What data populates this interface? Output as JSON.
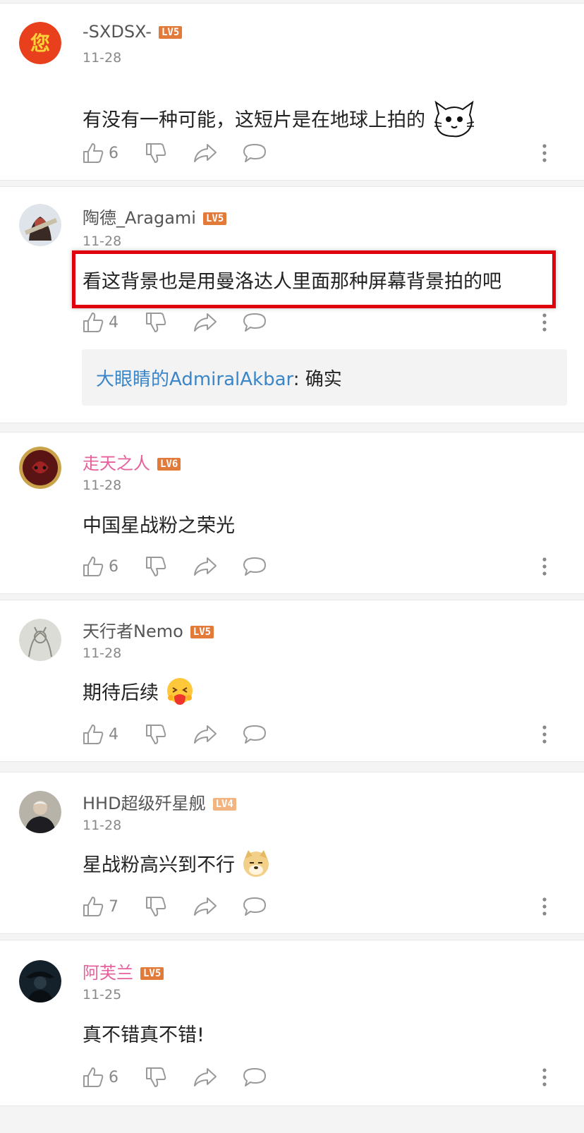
{
  "comments": [
    {
      "username": "-SXDSX-",
      "level": "LV5",
      "date": "11-28",
      "content": "有没有一种可能，这短片是在地球上拍的",
      "likes": "6"
    },
    {
      "username": "陶德_Aragami",
      "level": "LV5",
      "date": "11-28",
      "content": "看这背景也是用曼洛达人里面那种屏幕背景拍的吧",
      "likes": "4",
      "reply": {
        "author": "大眼睛的AdmiralAkbar",
        "separator": ": ",
        "text": "确实"
      }
    },
    {
      "username": "走天之人",
      "level": "LV6",
      "date": "11-28",
      "content": "中国星战粉之荣光",
      "likes": "6"
    },
    {
      "username": "天行者Nemo",
      "level": "LV5",
      "date": "11-28",
      "content": "期待后续",
      "likes": "4"
    },
    {
      "username": "HHD超级歼星舰",
      "level": "LV4",
      "date": "11-28",
      "content": "星战粉高兴到不行",
      "likes": "7"
    },
    {
      "username": "阿芙兰",
      "level": "LV5",
      "date": "11-25",
      "content": "真不错真不错!",
      "likes": "6"
    }
  ],
  "avatar_text": "您",
  "icons": [
    "like-icon",
    "dislike-icon",
    "share-icon",
    "reply-icon",
    "more-icon",
    "cat-emoji-icon",
    "hug-emoji-icon",
    "doge-emoji-icon"
  ],
  "colors": {
    "level_badge": "#e27b3a",
    "level_badge_lv4": "#f2b582",
    "pink_username": "#e6609c",
    "link_blue": "#3a86c8",
    "highlight_border": "#e0000b"
  }
}
